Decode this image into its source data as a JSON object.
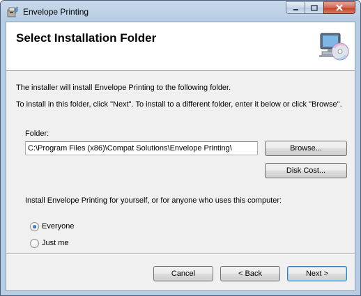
{
  "window": {
    "title": "Envelope Printing",
    "icon": "installer-icon"
  },
  "banner": {
    "title": "Select Installation Folder",
    "icon": "computer-cd-icon"
  },
  "body": {
    "intro": "The installer will install Envelope Printing to the following folder.",
    "instructions": "To install in this folder, click \"Next\". To install to a different folder, enter it below or click \"Browse\".",
    "folder_label": "Folder:",
    "folder_value": "C:\\Program Files (x86)\\Compat Solutions\\Envelope Printing\\",
    "browse_label": "Browse...",
    "disk_cost_label": "Disk Cost...",
    "install_for_text": "Install Envelope Printing for yourself, or for anyone who uses this computer:",
    "radio_options": [
      {
        "label": "Everyone",
        "selected": true
      },
      {
        "label": "Just me",
        "selected": false
      }
    ]
  },
  "footer": {
    "cancel_label": "Cancel",
    "back_label": "< Back",
    "next_label": "Next >"
  }
}
